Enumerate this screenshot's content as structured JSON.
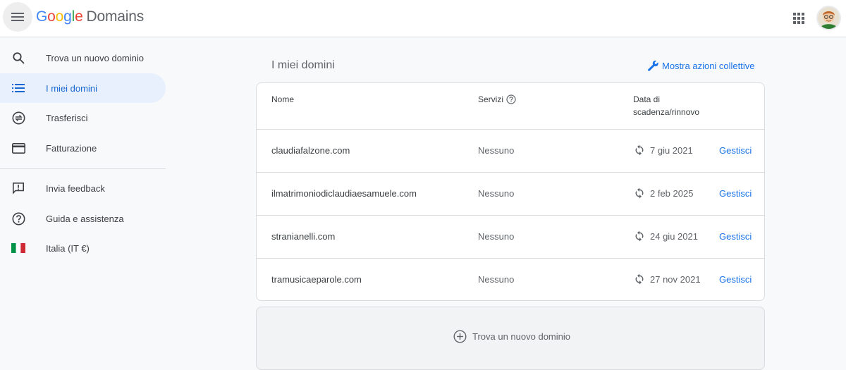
{
  "header": {
    "logo_google": [
      "G",
      "o",
      "o",
      "g",
      "l",
      "e"
    ],
    "logo_product": "Domains",
    "menu_icon": "hamburger-menu-icon",
    "apps_icon": "apps-grid-icon",
    "avatar_icon": "user-avatar"
  },
  "sidebar": {
    "items": [
      {
        "label": "Trova un nuovo dominio",
        "icon": "search-icon"
      },
      {
        "label": "I miei domini",
        "icon": "list-icon",
        "active": true
      },
      {
        "label": "Trasferisci",
        "icon": "transfer-icon"
      },
      {
        "label": "Fatturazione",
        "icon": "credit-card-icon"
      },
      {
        "label": "Invia feedback",
        "icon": "feedback-icon"
      },
      {
        "label": "Guida e assistenza",
        "icon": "help-icon"
      },
      {
        "label": "Italia (IT €)",
        "icon": "italy-flag-icon"
      }
    ]
  },
  "main": {
    "title": "I miei domini",
    "bulk_actions": "Mostra azioni collettive",
    "table": {
      "headers": {
        "name": "Nome",
        "services": "Servizi",
        "expiry_line1": "Data di",
        "expiry_line2": "scadenza/rinnovo"
      },
      "rows": [
        {
          "name": "claudiafalzone.com",
          "services": "Nessuno",
          "date": "7 giu 2021",
          "action": "Gestisci"
        },
        {
          "name": "ilmatrimoniodiclaudiaesamuele.com",
          "services": "Nessuno",
          "date": "2 feb 2025",
          "action": "Gestisci"
        },
        {
          "name": "stranianelli.com",
          "services": "Nessuno",
          "date": "24 giu 2021",
          "action": "Gestisci"
        },
        {
          "name": "tramusicaeparole.com",
          "services": "Nessuno",
          "date": "27 nov 2021",
          "action": "Gestisci"
        }
      ]
    },
    "find_domain": "Trova un nuovo dominio"
  },
  "colors": {
    "accent": "#1a73e8",
    "active_bg": "#e8f0fe",
    "flag_green": "#009246",
    "flag_red": "#ce2b37"
  }
}
